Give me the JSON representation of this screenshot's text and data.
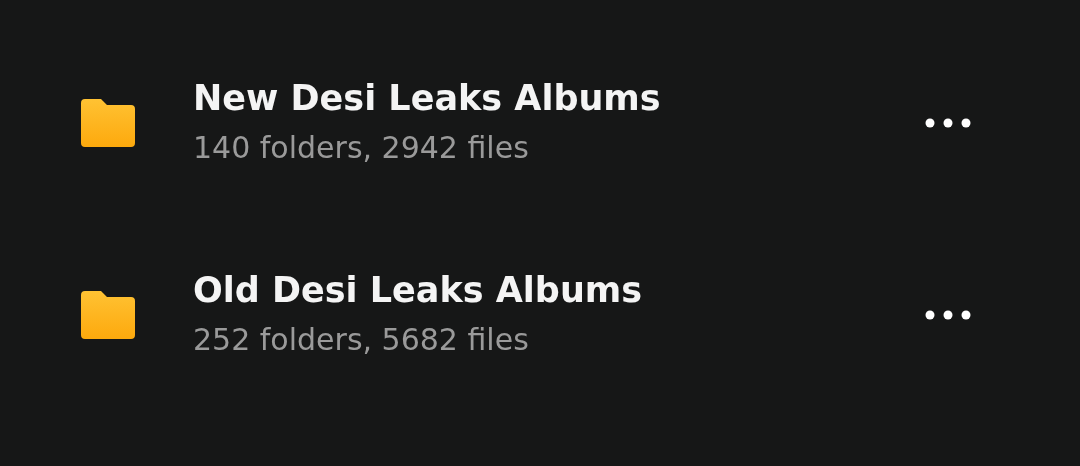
{
  "folders": [
    {
      "name": "New Desi Leaks Albums",
      "details": "140 folders, 2942 files"
    },
    {
      "name": "Old Desi Leaks Albums",
      "details": "252 folders, 5682 files"
    }
  ]
}
